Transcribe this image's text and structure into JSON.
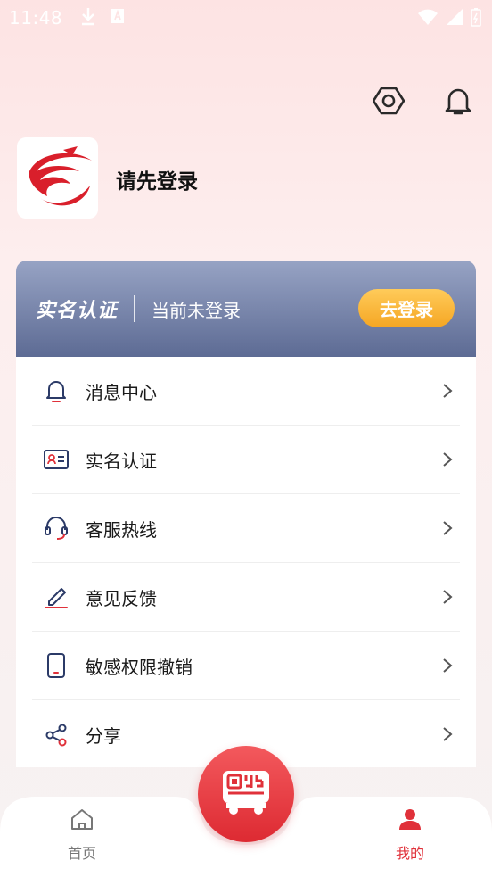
{
  "status_bar": {
    "time": "11:48"
  },
  "profile": {
    "login_prompt": "请先登录"
  },
  "verify_card": {
    "title": "实名认证",
    "status": "当前未登录",
    "login_button": "去登录"
  },
  "menu": {
    "items": [
      {
        "label": "消息中心",
        "icon": "bell-icon"
      },
      {
        "label": "实名认证",
        "icon": "id-card-icon"
      },
      {
        "label": "客服热线",
        "icon": "headset-icon"
      },
      {
        "label": "意见反馈",
        "icon": "edit-icon"
      },
      {
        "label": "敏感权限撤销",
        "icon": "phone-icon"
      },
      {
        "label": "分享",
        "icon": "share-icon"
      }
    ]
  },
  "tab_bar": {
    "home_label": "首页",
    "mine_label": "我的",
    "active_color": "#e0313a",
    "inactive_color": "#777777"
  },
  "colors": {
    "accent_red": "#e0313a",
    "card_blue": "#5d6b94",
    "login_orange": "#f5a623",
    "icon_navy": "#2b3a67"
  }
}
